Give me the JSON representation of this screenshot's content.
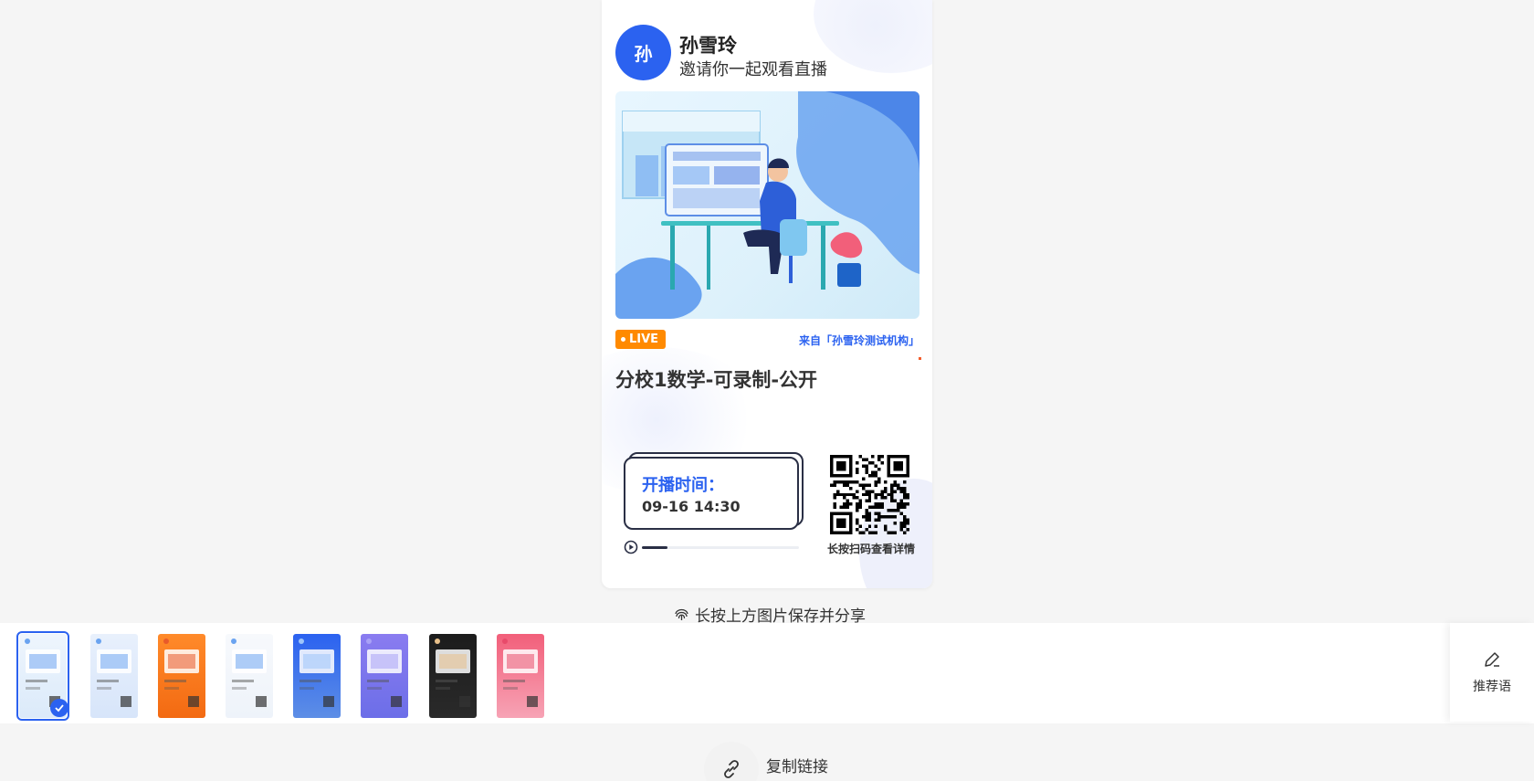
{
  "poster": {
    "avatar_text": "孙",
    "host_name": "孙雪玲",
    "invite_text": "邀请你一起观看直播",
    "live_badge": "LIVE",
    "from_org": "来自「孙雪玲测试机构」",
    "course_title": "分校1数学-可录制-公开",
    "time_label": "开播时间：",
    "time_value": "09-16 14:30",
    "qr_caption": "长按扫码查看详情",
    "progress": 0.16
  },
  "save_hint": "长按上方图片保存并分享",
  "templates": [
    {
      "id": "t1",
      "selected": true,
      "theme": "light-blue"
    },
    {
      "id": "t2",
      "selected": false,
      "theme": "soft-blue"
    },
    {
      "id": "t3",
      "selected": false,
      "theme": "orange"
    },
    {
      "id": "t4",
      "selected": false,
      "theme": "white"
    },
    {
      "id": "t5",
      "selected": false,
      "theme": "blue"
    },
    {
      "id": "t6",
      "selected": false,
      "theme": "purple"
    },
    {
      "id": "t7",
      "selected": false,
      "theme": "black-gold"
    },
    {
      "id": "t8",
      "selected": false,
      "theme": "pink"
    }
  ],
  "recommend_label": "推荐语",
  "copy_link_label": "复制链接",
  "colors": {
    "accent": "#2b62f0",
    "live": "#ff8a00",
    "background": "#f5f5f5"
  }
}
